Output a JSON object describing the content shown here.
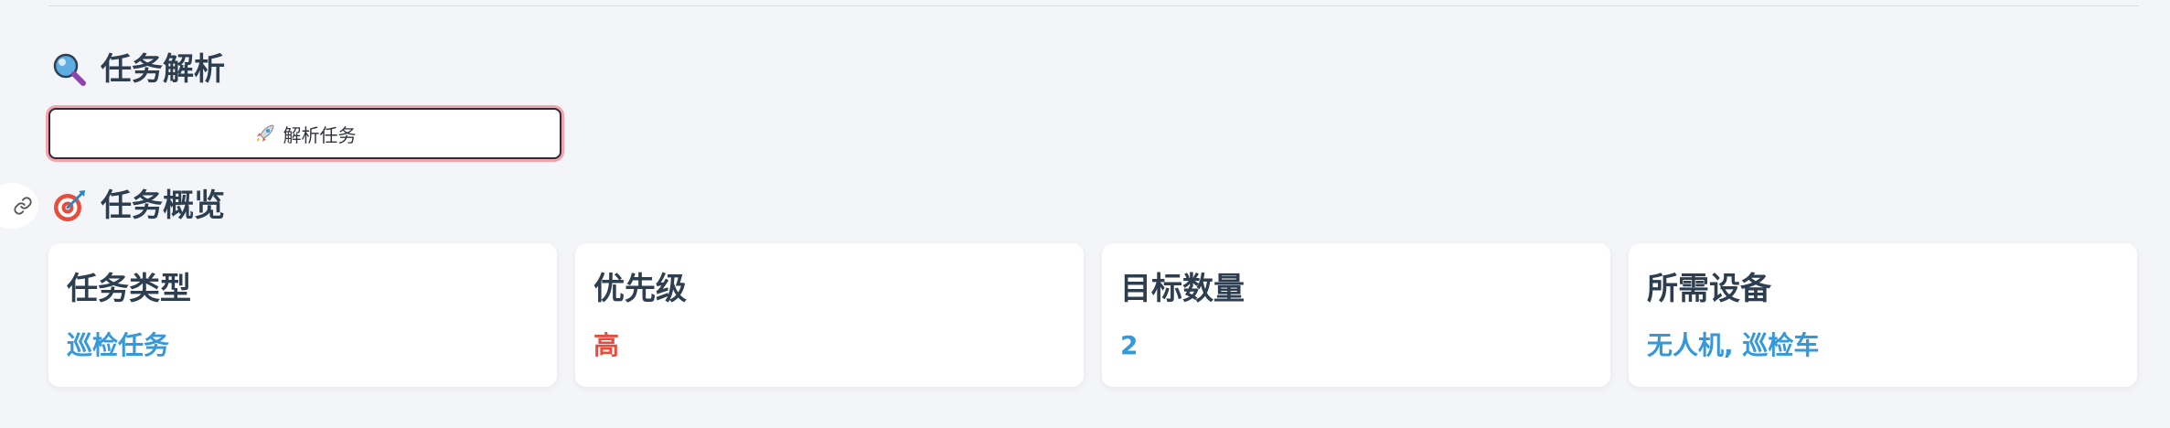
{
  "sections": {
    "task_parse": {
      "title": "任务解析",
      "icon": "magnifier-icon"
    },
    "task_overview": {
      "title": "任务概览",
      "icon": "target-icon"
    }
  },
  "parse_button": {
    "label": "解析任务",
    "icon": "rocket-icon"
  },
  "cards": [
    {
      "label": "任务类型",
      "value": "巡检任务",
      "value_color": "#3498db"
    },
    {
      "label": "优先级",
      "value": "高",
      "value_color": "#e74c3c"
    },
    {
      "label": "目标数量",
      "value": "2",
      "value_color": "#3498db"
    },
    {
      "label": "所需设备",
      "value": "无人机, 巡检车",
      "value_color": "#3498db"
    }
  ],
  "colors": {
    "background": "#f4f5f9",
    "heading": "#2c3e50",
    "accent_blue": "#3498db",
    "accent_red": "#e74c3c",
    "button_focus_ring": "#f5a3aa"
  }
}
